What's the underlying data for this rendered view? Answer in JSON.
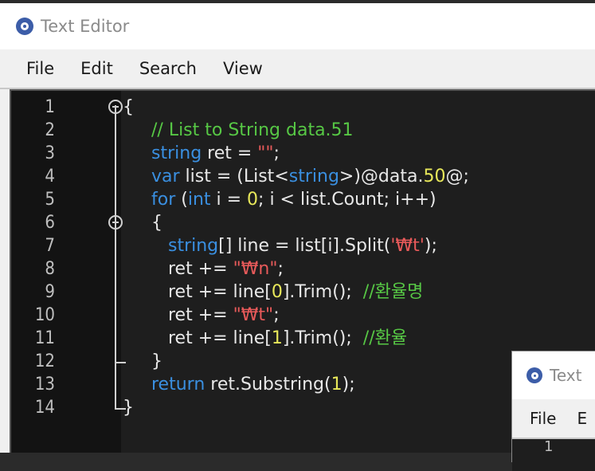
{
  "window": {
    "title": "Text Editor",
    "menu": [
      "File",
      "Edit",
      "Search",
      "View"
    ]
  },
  "editor": {
    "lines": [
      {
        "n": "1",
        "tokens": [
          {
            "t": "{",
            "c": "txt"
          }
        ]
      },
      {
        "n": "2",
        "tokens": [
          {
            "t": "// List to String data.51",
            "c": "cm"
          }
        ]
      },
      {
        "n": "3",
        "tokens": [
          {
            "t": "string",
            "c": "kw"
          },
          {
            "t": " ret = ",
            "c": "txt"
          },
          {
            "t": "\"\"",
            "c": "str"
          },
          {
            "t": ";",
            "c": "txt"
          }
        ]
      },
      {
        "n": "4",
        "tokens": [
          {
            "t": "var",
            "c": "kw"
          },
          {
            "t": " list = (List<",
            "c": "txt"
          },
          {
            "t": "string",
            "c": "kw"
          },
          {
            "t": ">)@data.",
            "c": "txt"
          },
          {
            "t": "50",
            "c": "num"
          },
          {
            "t": "@;",
            "c": "txt"
          }
        ]
      },
      {
        "n": "5",
        "tokens": [
          {
            "t": "for",
            "c": "kw"
          },
          {
            "t": " (",
            "c": "txt"
          },
          {
            "t": "int",
            "c": "kw"
          },
          {
            "t": " i = ",
            "c": "txt"
          },
          {
            "t": "0",
            "c": "num"
          },
          {
            "t": "; i < list.Count; i++)",
            "c": "txt"
          }
        ]
      },
      {
        "n": "6",
        "tokens": [
          {
            "t": "{",
            "c": "txt"
          }
        ]
      },
      {
        "n": "7",
        "tokens": [
          {
            "t": "   ",
            "c": "txt"
          },
          {
            "t": "string",
            "c": "kw"
          },
          {
            "t": "[] line = list[i].Split(",
            "c": "txt"
          },
          {
            "t": "'₩t'",
            "c": "str"
          },
          {
            "t": ");",
            "c": "txt"
          }
        ]
      },
      {
        "n": "8",
        "tokens": [
          {
            "t": "   ret += ",
            "c": "txt"
          },
          {
            "t": "\"₩n\"",
            "c": "str"
          },
          {
            "t": ";",
            "c": "txt"
          }
        ]
      },
      {
        "n": "9",
        "tokens": [
          {
            "t": "   ret += line[",
            "c": "txt"
          },
          {
            "t": "0",
            "c": "num"
          },
          {
            "t": "].Trim();  ",
            "c": "txt"
          },
          {
            "t": "//환율명",
            "c": "cm"
          }
        ]
      },
      {
        "n": "10",
        "tokens": [
          {
            "t": "   ret += ",
            "c": "txt"
          },
          {
            "t": "\"₩t\"",
            "c": "str"
          },
          {
            "t": ";",
            "c": "txt"
          }
        ]
      },
      {
        "n": "11",
        "tokens": [
          {
            "t": "   ret += line[",
            "c": "txt"
          },
          {
            "t": "1",
            "c": "num"
          },
          {
            "t": "].Trim();  ",
            "c": "txt"
          },
          {
            "t": "//환율",
            "c": "cm"
          }
        ]
      },
      {
        "n": "12",
        "tokens": [
          {
            "t": "}",
            "c": "txt"
          }
        ]
      },
      {
        "n": "13",
        "tokens": [
          {
            "t": "return",
            "c": "kw"
          },
          {
            "t": " ret.Substring(",
            "c": "txt"
          },
          {
            "t": "1",
            "c": "num"
          },
          {
            "t": ");",
            "c": "txt"
          }
        ]
      },
      {
        "n": "14",
        "tokens": [
          {
            "t": "}",
            "c": "txt"
          }
        ]
      }
    ]
  },
  "second_window": {
    "title": "Text",
    "menu": [
      "File",
      "E"
    ],
    "first_line_number": "1"
  },
  "colors": {
    "keyword": "#3a8fe0",
    "comment": "#57c845",
    "number": "#e8e85a",
    "string": "#e85a5a",
    "text": "#e8e8e8"
  }
}
